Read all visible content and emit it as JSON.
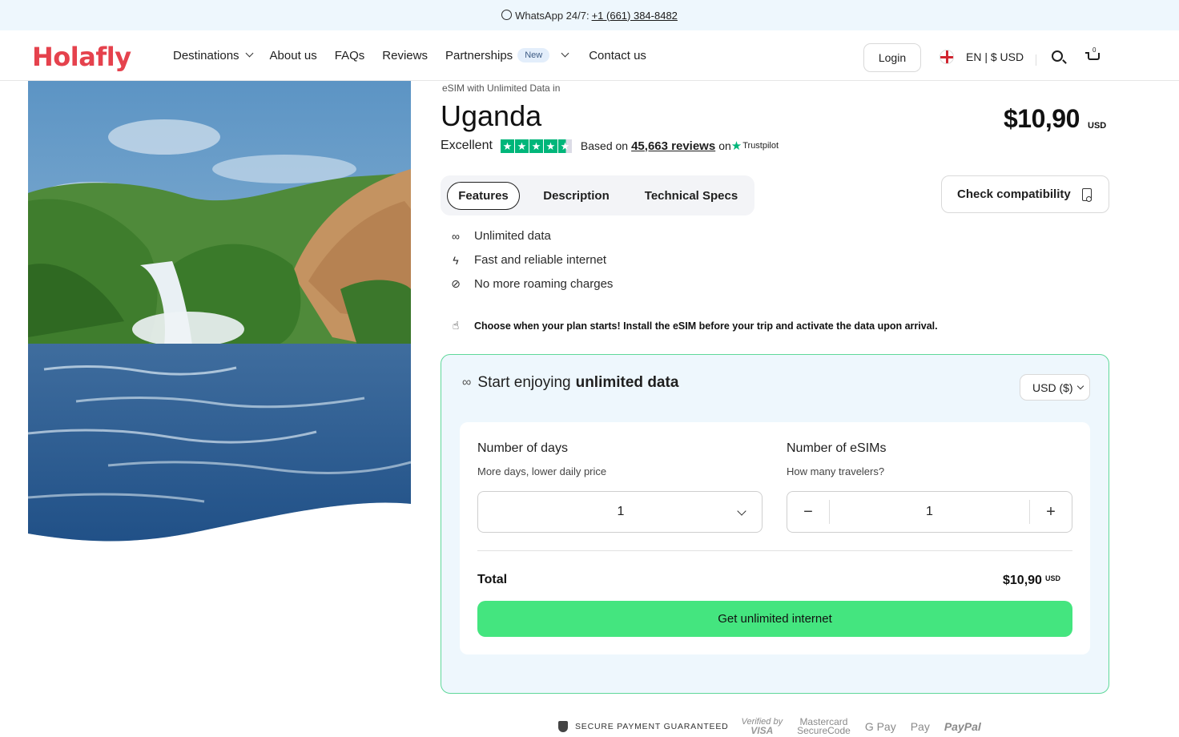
{
  "banner": {
    "prefix": "WhatsApp 24/7:",
    "phone": "+1 (661) 384-8482",
    "icon": "whatsapp-icon"
  },
  "nav": {
    "logo": "Holafly",
    "items": [
      {
        "label": "Destinations",
        "has_dropdown": true
      },
      {
        "label": "About us"
      },
      {
        "label": "FAQs"
      },
      {
        "label": "Reviews"
      },
      {
        "label": "Partnerships",
        "badge": "New",
        "has_dropdown": true
      },
      {
        "label": "Contact us"
      }
    ],
    "login": "Login",
    "language": "EN | $ USD",
    "cart_count": "0"
  },
  "product": {
    "eyebrow": "eSIM with Unlimited Data in",
    "title": "Uganda",
    "rating_word": "Excellent",
    "rating_stars": 4.5,
    "reviews_prefix": "Based on",
    "reviews_count": "45,663 reviews",
    "reviews_on": "on",
    "reviews_source": "Trustpilot",
    "price": "$10,90",
    "price_currency": "USD"
  },
  "tabs": [
    {
      "label": "Features",
      "active": true
    },
    {
      "label": "Description",
      "active": false
    },
    {
      "label": "Technical Specs",
      "active": false
    }
  ],
  "check_compatibility": "Check compatibility",
  "features": [
    {
      "icon": "infinity-icon",
      "label": "Unlimited data"
    },
    {
      "icon": "lightning-icon",
      "label": "Fast and reliable internet"
    },
    {
      "icon": "no-roaming-icon",
      "label": "No more roaming charges"
    }
  ],
  "activation_note": "Choose when your plan starts! Install the eSIM before your trip and activate the data upon arrival.",
  "card": {
    "heading_prefix": "Start enjoying",
    "heading_bold": "unlimited data",
    "currency_select": "USD ($)",
    "days_label": "Number of days",
    "days_sub": "More days, lower daily price",
    "days_value": "1",
    "esims_label": "Number of eSIMs",
    "esims_sub": "How many travelers?",
    "esims_value": "1",
    "total_label": "Total",
    "total_value": "$10,90",
    "total_currency": "USD",
    "cta": "Get unlimited internet"
  },
  "payment": {
    "secure": "SECURE PAYMENT GUARANTEED",
    "methods": [
      "Verified by",
      "VISA",
      "Mastercard",
      "SecureCode",
      "G Pay",
      "Pay",
      "PayPal"
    ]
  },
  "colors": {
    "brand": "#e5424d",
    "cta": "#44e57f",
    "card_bg": "#eef7fd",
    "card_border": "#5fd89a",
    "trustpilot": "#00b67a"
  }
}
